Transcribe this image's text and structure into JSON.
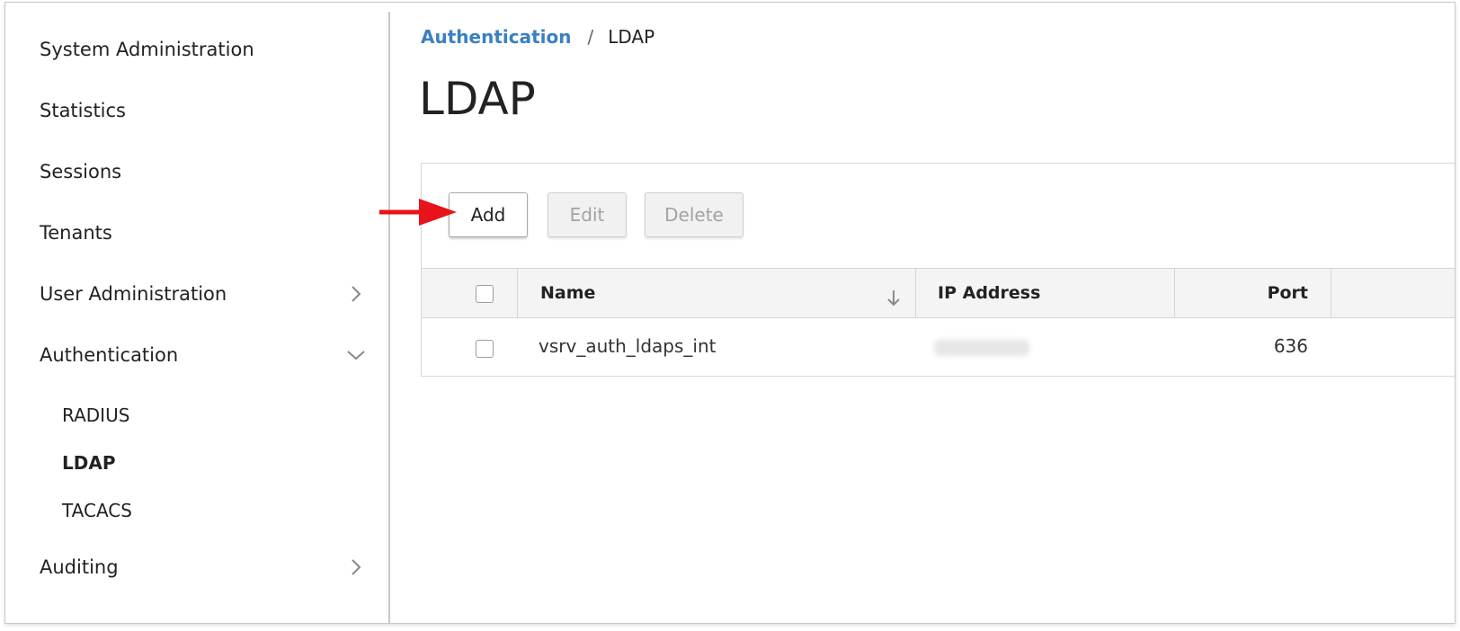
{
  "sidebar": {
    "items": [
      {
        "label": "System Administration"
      },
      {
        "label": "Statistics"
      },
      {
        "label": "Sessions"
      },
      {
        "label": "Tenants"
      },
      {
        "label": "User Administration",
        "icon": "chevron-right-icon"
      },
      {
        "label": "Authentication",
        "icon": "chevron-down-icon"
      },
      {
        "label": "Auditing",
        "icon": "chevron-right-icon"
      }
    ],
    "sub_items": [
      {
        "label": "RADIUS"
      },
      {
        "label": "LDAP",
        "active": true
      },
      {
        "label": "TACACS"
      }
    ]
  },
  "breadcrumb": {
    "link": "Authentication",
    "separator": "/",
    "current": "LDAP"
  },
  "page": {
    "title": "LDAP"
  },
  "toolbar": {
    "add_label": "Add",
    "edit_label": "Edit",
    "delete_label": "Delete"
  },
  "table": {
    "columns": [
      "Name",
      "IP Address",
      "Port"
    ],
    "sort_icon": "sort-down-arrow-icon",
    "rows": [
      {
        "name": "vsrv_auth_ldaps_int",
        "ip_address": "",
        "port": "636"
      }
    ]
  },
  "colors": {
    "link": "#3a80c3",
    "annotation_arrow": "#e8131a",
    "header_bg": "#f4f4f4"
  }
}
